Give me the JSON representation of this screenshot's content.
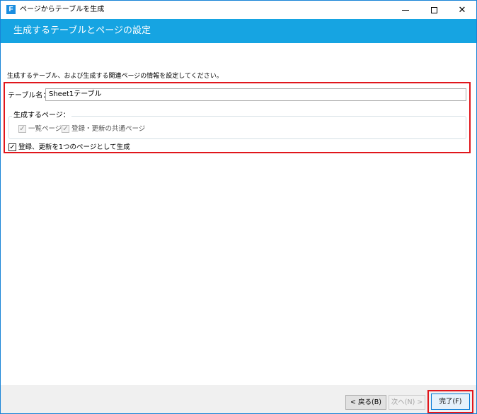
{
  "window": {
    "title": "ページからテーブルを生成",
    "app_icon_letter": "F",
    "controls": {
      "minimize": "minimize-icon",
      "maximize": "maximize-icon",
      "close": "close-icon"
    }
  },
  "header": {
    "title": "生成するテーブルとページの設定"
  },
  "main": {
    "intro": "生成するテーブル、および生成する関連ページの情報を設定してください。",
    "table_name_label": "テーブル名：",
    "table_name_value": "Sheet1テーブル",
    "group_label": "生成するページ：",
    "list_page_label": "一覧ページ",
    "shared_page_label": "登録・更新の共通ページ",
    "single_page_label": "登録、更新を1つのページとして生成"
  },
  "footer": {
    "back_label": "< 戻る(B)",
    "next_label": "次へ(N) >",
    "finish_label": "完了(F)"
  },
  "colors": {
    "header": "#16a4e2",
    "highlight": "#e0161c",
    "accent": "#1a8ee0"
  }
}
